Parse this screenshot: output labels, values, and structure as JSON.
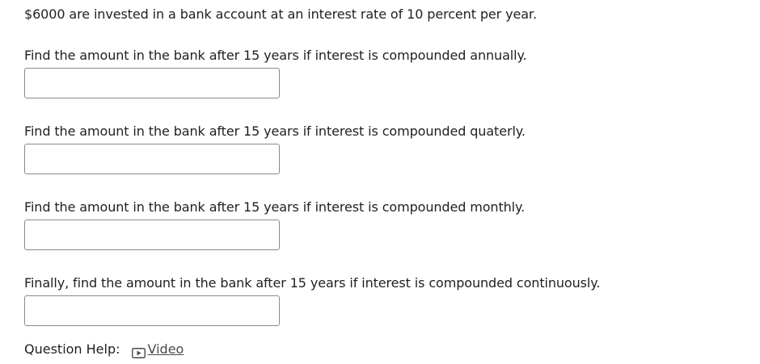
{
  "intro": "$6000 are invested in a bank account at an interest rate of 10 percent per year.",
  "questions": [
    {
      "text": "Find the amount in the bank after 15 years if interest is compounded annually.",
      "answer": ""
    },
    {
      "text": "Find the amount in the bank after 15 years if interest is compounded quaterly.",
      "answer": ""
    },
    {
      "text": "Find the amount in the bank after 15 years if interest is compounded monthly.",
      "answer": ""
    },
    {
      "text": "Finally, find the amount in the bank after 15 years if interest is compounded continuously.",
      "answer": ""
    }
  ],
  "help": {
    "label": "Question Help:",
    "video_label": "Video",
    "video_icon": "play-video-icon"
  }
}
